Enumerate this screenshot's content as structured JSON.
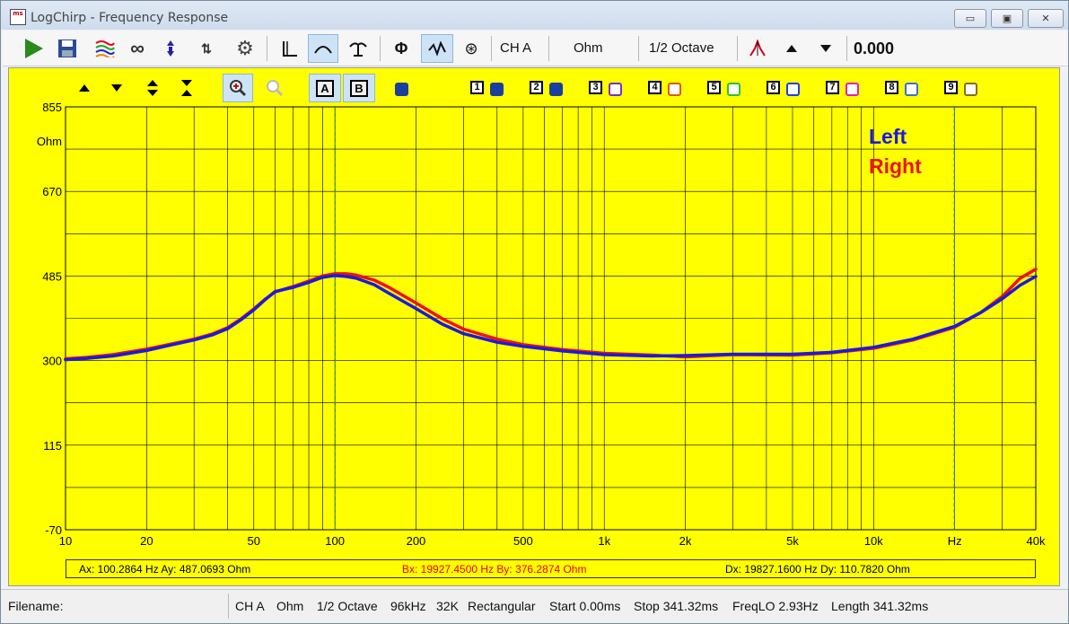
{
  "window": {
    "title": "LogChirp - Frequency Response",
    "icon_text": "ms"
  },
  "window_controls": {
    "minimize": "▭",
    "maximize": "▣",
    "close": "✕"
  },
  "toolbar": {
    "channel": "CH A",
    "unit": "Ohm",
    "smoothing": "1/2 Octave",
    "value": "0.000",
    "icons": [
      "play-icon",
      "save-icon",
      "overlay-icon",
      "infinity-icon",
      "marker-icon",
      "sweep-icon",
      "gear-icon",
      "ir-icon",
      "fr-icon",
      "step-icon",
      "phase-icon",
      "group-delay-icon",
      "speaker-icon",
      "peak-icon",
      "arrow-up-icon",
      "arrow-down-icon"
    ]
  },
  "plot_controls": {
    "zoom_in": "🔍",
    "zoom_out": "🔍",
    "cursor_a": "A",
    "cursor_b": "B",
    "overlays": [
      "1",
      "2",
      "3",
      "4",
      "5",
      "6",
      "7",
      "8",
      "9"
    ],
    "overlay_colors": [
      "#1a3f9e",
      "#1a3f9e",
      "#7a2fc0",
      "#e05a10",
      "#30c030",
      "#2040e0",
      "#e020c0",
      "#3a70d0",
      "#8a6a20"
    ]
  },
  "readout": {
    "a": "Ax: 100.2864 Hz  Ay: 487.0693 Ohm",
    "b": "Bx: 19927.4500 Hz  By: 376.2874 Ohm",
    "d": "Dx: 19827.1600 Hz  Dy: 110.7820 Ohm"
  },
  "status": {
    "filename_label": "Filename:",
    "channel": "CH A",
    "unit": "Ohm",
    "smoothing": "1/2 Octave",
    "rate": "96kHz",
    "size": "32K",
    "window_fn": "Rectangular",
    "start": "Start 0.00ms",
    "stop": "Stop 341.32ms",
    "freqlo": "FreqLO 2.93Hz",
    "length": "Length 341.32ms"
  },
  "colors": {
    "background": "#ffff00",
    "left": "#1a1ae0",
    "right": "#ee1111",
    "cursor": "#2aa55a"
  },
  "chart_data": {
    "type": "line",
    "x_scale": "log",
    "xlim": [
      10,
      40000
    ],
    "ylim": [
      -70,
      855
    ],
    "x_ticks": [
      {
        "value": 10,
        "label": "10"
      },
      {
        "value": 20,
        "label": "20"
      },
      {
        "value": 50,
        "label": "50"
      },
      {
        "value": 100,
        "label": "100"
      },
      {
        "value": 200,
        "label": "200"
      },
      {
        "value": 500,
        "label": "500"
      },
      {
        "value": 1000,
        "label": "1k"
      },
      {
        "value": 2000,
        "label": "2k"
      },
      {
        "value": 5000,
        "label": "5k"
      },
      {
        "value": 10000,
        "label": "10k"
      },
      {
        "value": 20000,
        "label": "Hz"
      },
      {
        "value": 40000,
        "label": "40k"
      }
    ],
    "y_ticks": [
      {
        "value": 855,
        "label": "855"
      },
      {
        "value": 670,
        "label": "670"
      },
      {
        "value": 485,
        "label": "485"
      },
      {
        "value": 300,
        "label": "300"
      },
      {
        "value": 115,
        "label": "115"
      },
      {
        "value": -70,
        "label": "-70"
      }
    ],
    "y_unit": "Ohm",
    "grid": true,
    "legend_position": "top-right",
    "cursors": {
      "a_x": 100.2864,
      "b_x": 19927.45
    },
    "series": [
      {
        "name": "Left",
        "color": "#1a1ae0",
        "x": [
          10,
          12,
          15,
          20,
          25,
          30,
          35,
          40,
          45,
          50,
          55,
          60,
          70,
          80,
          90,
          100,
          110,
          120,
          140,
          160,
          200,
          250,
          300,
          400,
          500,
          700,
          1000,
          1500,
          2000,
          3000,
          5000,
          7000,
          10000,
          14000,
          20000,
          25000,
          30000,
          35000,
          40000
        ],
        "y": [
          302,
          305,
          310,
          322,
          335,
          345,
          356,
          370,
          390,
          411,
          433,
          451,
          460,
          471,
          482,
          486,
          484,
          480,
          466,
          446,
          414,
          380,
          359,
          340,
          331,
          321,
          313,
          310,
          311,
          314,
          314,
          318,
          329,
          347,
          375,
          405,
          435,
          465,
          484
        ]
      },
      {
        "name": "Right",
        "color": "#ee1111",
        "x": [
          10,
          12,
          15,
          20,
          25,
          30,
          35,
          40,
          45,
          50,
          55,
          60,
          70,
          80,
          90,
          100,
          110,
          120,
          140,
          160,
          200,
          250,
          300,
          400,
          500,
          700,
          1000,
          1500,
          2000,
          3000,
          5000,
          7000,
          10000,
          14000,
          20000,
          25000,
          30000,
          35000,
          40000
        ],
        "y": [
          304,
          307,
          313,
          325,
          337,
          347,
          358,
          372,
          392,
          413,
          434,
          450,
          462,
          474,
          485,
          490,
          490,
          487,
          476,
          459,
          426,
          392,
          369,
          347,
          335,
          324,
          316,
          312,
          308,
          313,
          312,
          317,
          327,
          345,
          373,
          405,
          440,
          480,
          500
        ]
      }
    ]
  }
}
